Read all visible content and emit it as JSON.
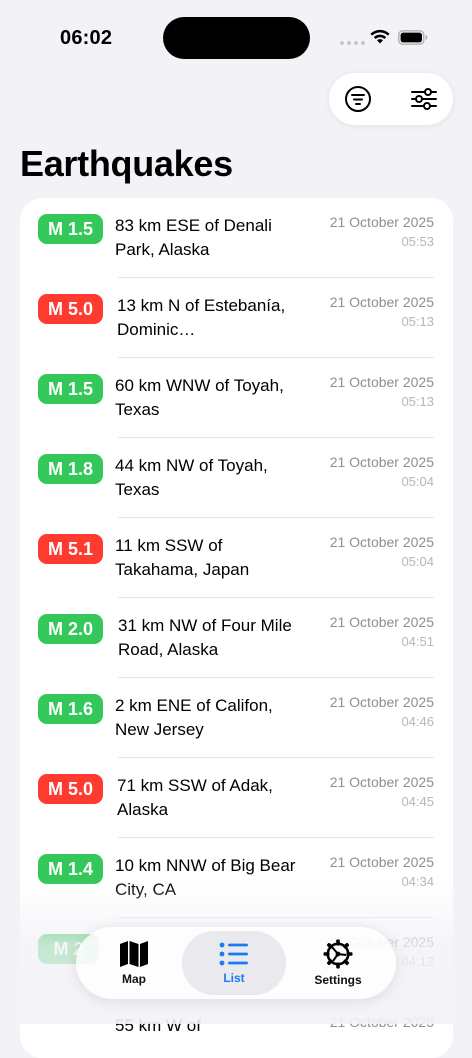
{
  "status_bar": {
    "time": "06:02"
  },
  "page": {
    "title": "Earthquakes"
  },
  "colors": {
    "low": "#34c759",
    "high": "#ff3b30",
    "accent": "#1a7cf5"
  },
  "quakes": [
    {
      "mag": "M 1.5",
      "level": "low",
      "place": "83 km ESE of Denali Park, Alaska",
      "date": "21 October 2025",
      "time": "05:53"
    },
    {
      "mag": "M 5.0",
      "level": "high",
      "place": "13 km N of Estebanía, Dominic…",
      "date": "21 October 2025",
      "time": "05:13"
    },
    {
      "mag": "M 1.5",
      "level": "low",
      "place": "60 km WNW of Toyah, Texas",
      "date": "21 October 2025",
      "time": "05:13"
    },
    {
      "mag": "M 1.8",
      "level": "low",
      "place": "44 km NW of Toyah, Texas",
      "date": "21 October 2025",
      "time": "05:04"
    },
    {
      "mag": "M 5.1",
      "level": "high",
      "place": "11 km SSW of Takahama, Japan",
      "date": "21 October 2025",
      "time": "05:04"
    },
    {
      "mag": "M 2.0",
      "level": "low",
      "place": "31 km NW of Four Mile Road, Alaska",
      "date": "21 October 2025",
      "time": "04:51"
    },
    {
      "mag": "M 1.6",
      "level": "low",
      "place": "2 km ENE of Califon, New Jersey",
      "date": "21 October 2025",
      "time": "04:46"
    },
    {
      "mag": "M 5.0",
      "level": "high",
      "place": "71 km SSW of Adak, Alaska",
      "date": "21 October 2025",
      "time": "04:45"
    },
    {
      "mag": "M 1.4",
      "level": "low",
      "place": "10 km NNW of Big Bear City, CA",
      "date": "21 October 2025",
      "time": "04:34"
    },
    {
      "mag": "M 2",
      "level": "low",
      "place": "",
      "date": "21 October 2025",
      "time": "04:12"
    },
    {
      "mag": "",
      "level": "low",
      "place": "55 km W of",
      "date": "21 October 2025",
      "time": ""
    }
  ],
  "tabs": [
    {
      "label": "Map",
      "icon": "map-icon"
    },
    {
      "label": "List",
      "icon": "list-icon"
    },
    {
      "label": "Settings",
      "icon": "gear-icon"
    }
  ]
}
